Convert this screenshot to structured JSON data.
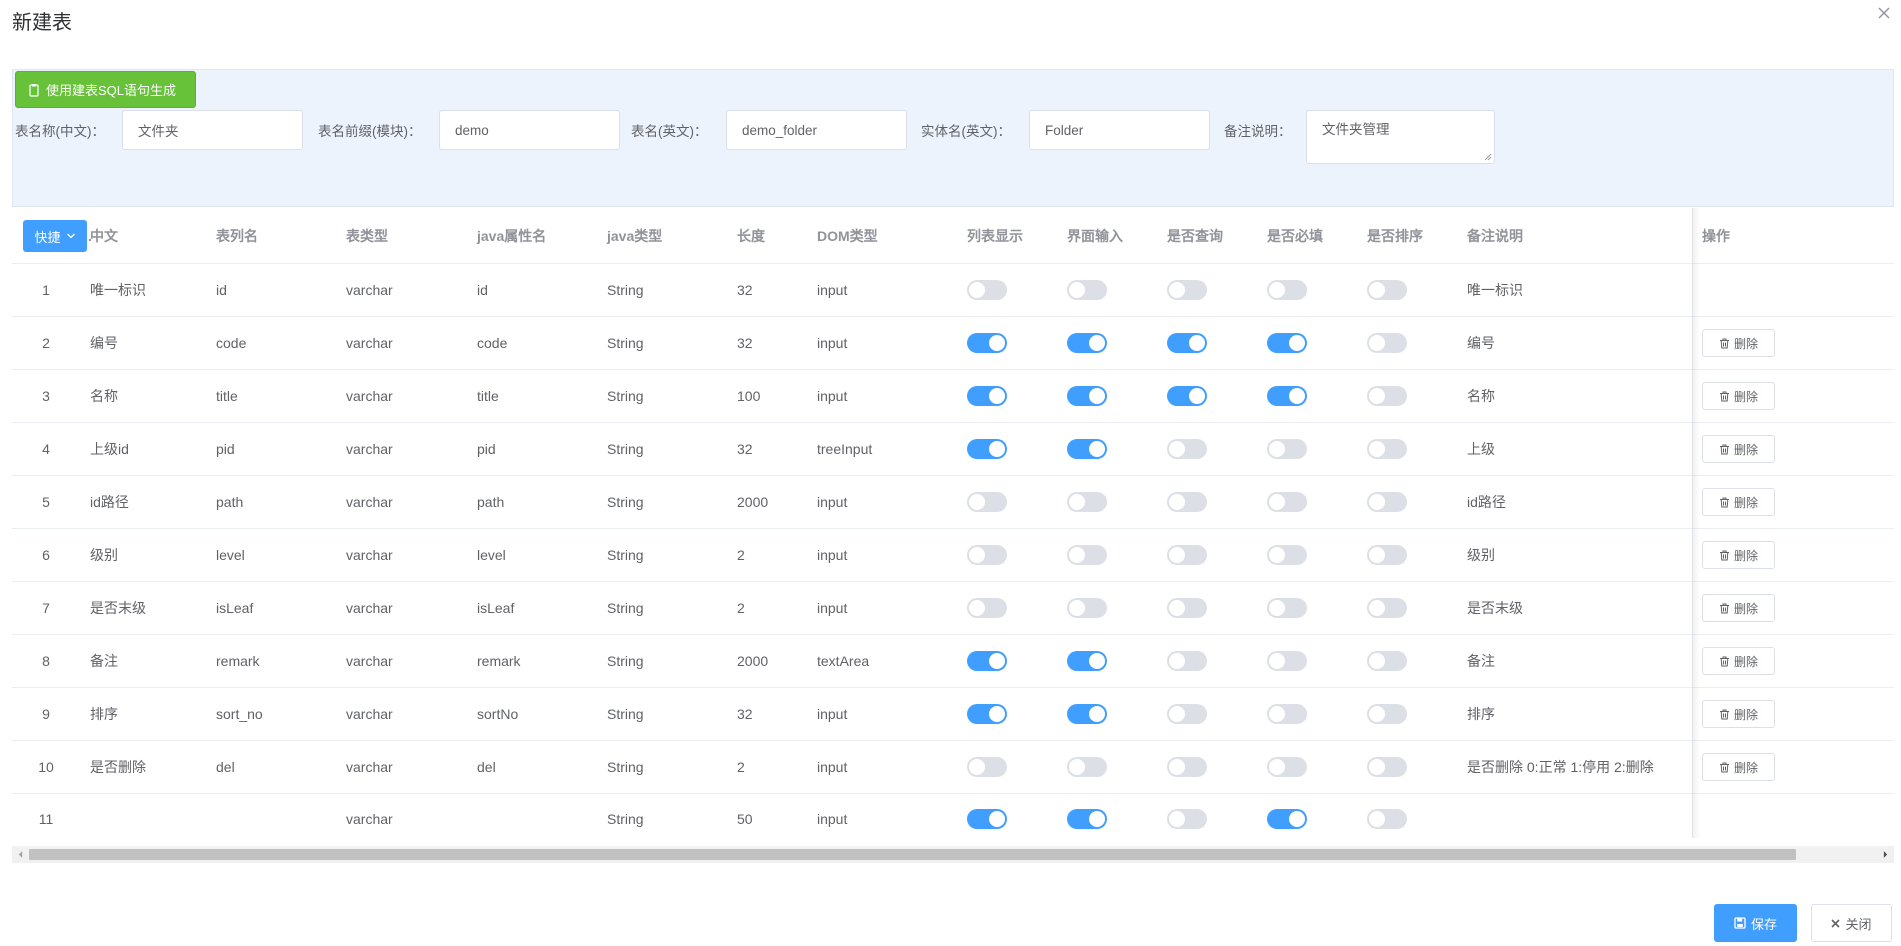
{
  "dialog": {
    "title": "新建表"
  },
  "form": {
    "sql_button_label": "使用建表SQL语句生成",
    "fields": [
      {
        "label": "表名称(中文)：",
        "value": "文件夹"
      },
      {
        "label": "表名前缀(模块)：",
        "value": "demo"
      },
      {
        "label": "表名(英文)：",
        "value": "demo_folder"
      },
      {
        "label": "实体名(英文)：",
        "value": "Folder"
      },
      {
        "label": "备注说明：",
        "value": "文件夹管理"
      }
    ]
  },
  "table": {
    "quick_button_label": "快捷",
    "columns": [
      "中文",
      "表列名",
      "表类型",
      "java属性名",
      "java类型",
      "长度",
      "DOM类型",
      "列表显示",
      "界面输入",
      "是否查询",
      "是否必填",
      "是否排序",
      "备注说明",
      "操作"
    ],
    "delete_label": "删除",
    "rows": [
      {
        "index": "1",
        "cn": "唯一标识",
        "col": "id",
        "type": "varchar",
        "prop": "id",
        "jtype": "String",
        "len": "32",
        "dom": "input",
        "list": false,
        "form": false,
        "query": false,
        "required": false,
        "sort": false,
        "remark": "唯一标识",
        "deletable": false
      },
      {
        "index": "2",
        "cn": "编号",
        "col": "code",
        "type": "varchar",
        "prop": "code",
        "jtype": "String",
        "len": "32",
        "dom": "input",
        "list": true,
        "form": true,
        "query": true,
        "required": true,
        "sort": false,
        "remark": "编号",
        "deletable": true
      },
      {
        "index": "3",
        "cn": "名称",
        "col": "title",
        "type": "varchar",
        "prop": "title",
        "jtype": "String",
        "len": "100",
        "dom": "input",
        "list": true,
        "form": true,
        "query": true,
        "required": true,
        "sort": false,
        "remark": "名称",
        "deletable": true
      },
      {
        "index": "4",
        "cn": "上级id",
        "col": "pid",
        "type": "varchar",
        "prop": "pid",
        "jtype": "String",
        "len": "32",
        "dom": "treeInput",
        "list": true,
        "form": true,
        "query": false,
        "required": false,
        "sort": false,
        "remark": "上级",
        "deletable": true
      },
      {
        "index": "5",
        "cn": "id路径",
        "col": "path",
        "type": "varchar",
        "prop": "path",
        "jtype": "String",
        "len": "2000",
        "dom": "input",
        "list": false,
        "form": false,
        "query": false,
        "required": false,
        "sort": false,
        "remark": "id路径",
        "deletable": true
      },
      {
        "index": "6",
        "cn": "级别",
        "col": "level",
        "type": "varchar",
        "prop": "level",
        "jtype": "String",
        "len": "2",
        "dom": "input",
        "list": false,
        "form": false,
        "query": false,
        "required": false,
        "sort": false,
        "remark": "级别",
        "deletable": true
      },
      {
        "index": "7",
        "cn": "是否末级",
        "col": "isLeaf",
        "type": "varchar",
        "prop": "isLeaf",
        "jtype": "String",
        "len": "2",
        "dom": "input",
        "list": false,
        "form": false,
        "query": false,
        "required": false,
        "sort": false,
        "remark": "是否末级",
        "deletable": true
      },
      {
        "index": "8",
        "cn": "备注",
        "col": "remark",
        "type": "varchar",
        "prop": "remark",
        "jtype": "String",
        "len": "2000",
        "dom": "textArea",
        "list": true,
        "form": true,
        "query": false,
        "required": false,
        "sort": false,
        "remark": "备注",
        "deletable": true
      },
      {
        "index": "9",
        "cn": "排序",
        "col": "sort_no",
        "type": "varchar",
        "prop": "sortNo",
        "jtype": "String",
        "len": "32",
        "dom": "input",
        "list": true,
        "form": true,
        "query": false,
        "required": false,
        "sort": false,
        "remark": "排序",
        "deletable": true
      },
      {
        "index": "10",
        "cn": "是否删除",
        "col": "del",
        "type": "varchar",
        "prop": "del",
        "jtype": "String",
        "len": "2",
        "dom": "input",
        "list": false,
        "form": false,
        "query": false,
        "required": false,
        "sort": false,
        "remark": "是否删除 0:正常 1:停用 2:删除",
        "deletable": true
      },
      {
        "index": "11",
        "cn": "",
        "col": "",
        "type": "varchar",
        "prop": "",
        "jtype": "String",
        "len": "50",
        "dom": "input",
        "list": true,
        "form": true,
        "query": false,
        "required": true,
        "sort": false,
        "remark": "",
        "deletable": false
      }
    ]
  },
  "footer": {
    "save_label": "保存",
    "close_label": "关闭"
  },
  "colors": {
    "primary": "#409eff",
    "success": "#67c23a",
    "switch_off": "#dcdfe6"
  }
}
